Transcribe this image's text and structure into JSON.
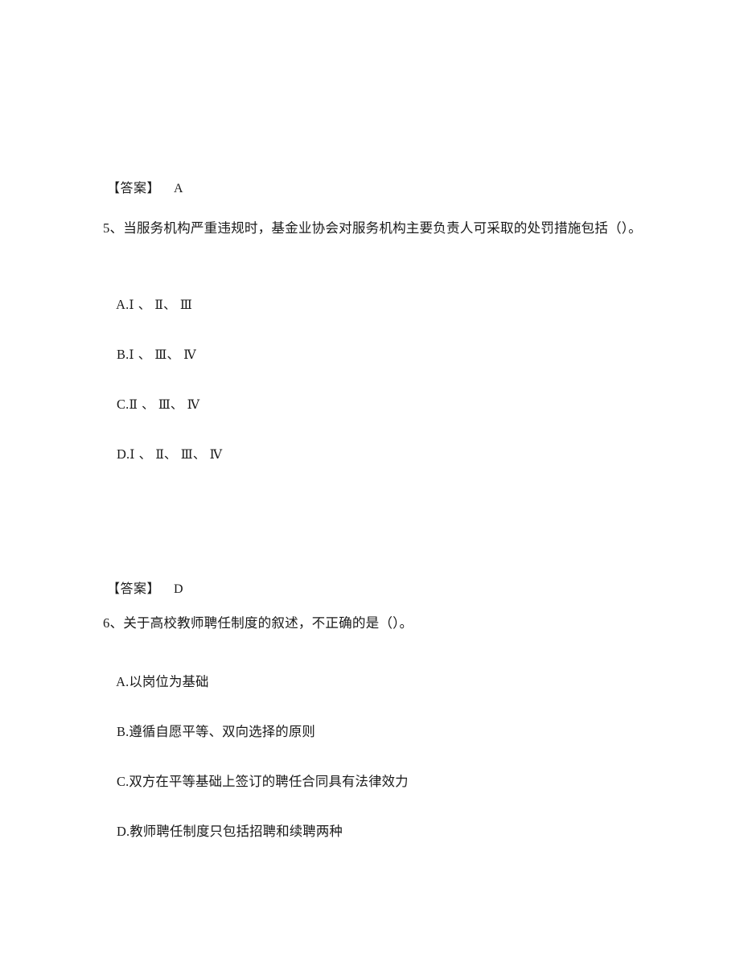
{
  "document": {
    "background_color": "#ffffff",
    "text_color": "#1a1a1a",
    "answer_label": "【答案】"
  },
  "blocks": [
    {
      "kind": "answer",
      "label": "【答案】",
      "value": "A"
    },
    {
      "kind": "question",
      "number": "5",
      "stem": "5、当服务机构严重违规时，基金业协会对服务机构主要负责人可采取的处罚措施包括（）。",
      "options": [
        {
          "letter": "A.",
          "text": "Ⅰ 、 Ⅱ、 Ⅲ"
        },
        {
          "letter": "B.",
          "text": "Ⅰ 、 Ⅲ、 Ⅳ"
        },
        {
          "letter": "C.",
          "text": "Ⅱ 、 Ⅲ、 Ⅳ"
        },
        {
          "letter": "D.",
          "text": "Ⅰ 、 Ⅱ、 Ⅲ、 Ⅳ"
        }
      ]
    },
    {
      "kind": "answer",
      "label": "【答案】",
      "value": "D"
    },
    {
      "kind": "question",
      "number": "6",
      "stem": "6、关于高校教师聘任制度的叙述，不正确的是（）。",
      "options": [
        {
          "letter": "A.",
          "text": "以岗位为基础"
        },
        {
          "letter": "B.",
          "text": "遵循自愿平等、双向选择的原则"
        },
        {
          "letter": "C.",
          "text": "双方在平等基础上签订的聘任合同具有法律效力"
        },
        {
          "letter": "D.",
          "text": "教师聘任制度只包括招聘和续聘两种"
        }
      ]
    }
  ],
  "q5": {
    "answer_label": "【答案】",
    "answer_value": "A",
    "stem": "5、当服务机构严重违规时，基金业协会对服务机构主要负责人可采取的处罚措施包括（）。",
    "opt_a_letter": "A.",
    "opt_a_text": "Ⅰ 、 Ⅱ、 Ⅲ",
    "opt_b_letter": "B.",
    "opt_b_text": "Ⅰ 、 Ⅲ、 Ⅳ",
    "opt_c_letter": "C.",
    "opt_c_text": "Ⅱ 、 Ⅲ、 Ⅳ",
    "opt_d_letter": "D.",
    "opt_d_text": "Ⅰ 、 Ⅱ、 Ⅲ、 Ⅳ"
  },
  "q6": {
    "answer_label": "【答案】",
    "answer_value": "D",
    "stem": "6、关于高校教师聘任制度的叙述，不正确的是（）。",
    "opt_a_letter": "A.",
    "opt_a_text": "以岗位为基础",
    "opt_b_letter": "B.",
    "opt_b_text": "遵循自愿平等、双向选择的原则",
    "opt_c_letter": "C.",
    "opt_c_text": "双方在平等基础上签订的聘任合同具有法律效力",
    "opt_d_letter": "D.",
    "opt_d_text": "教师聘任制度只包括招聘和续聘两种"
  }
}
